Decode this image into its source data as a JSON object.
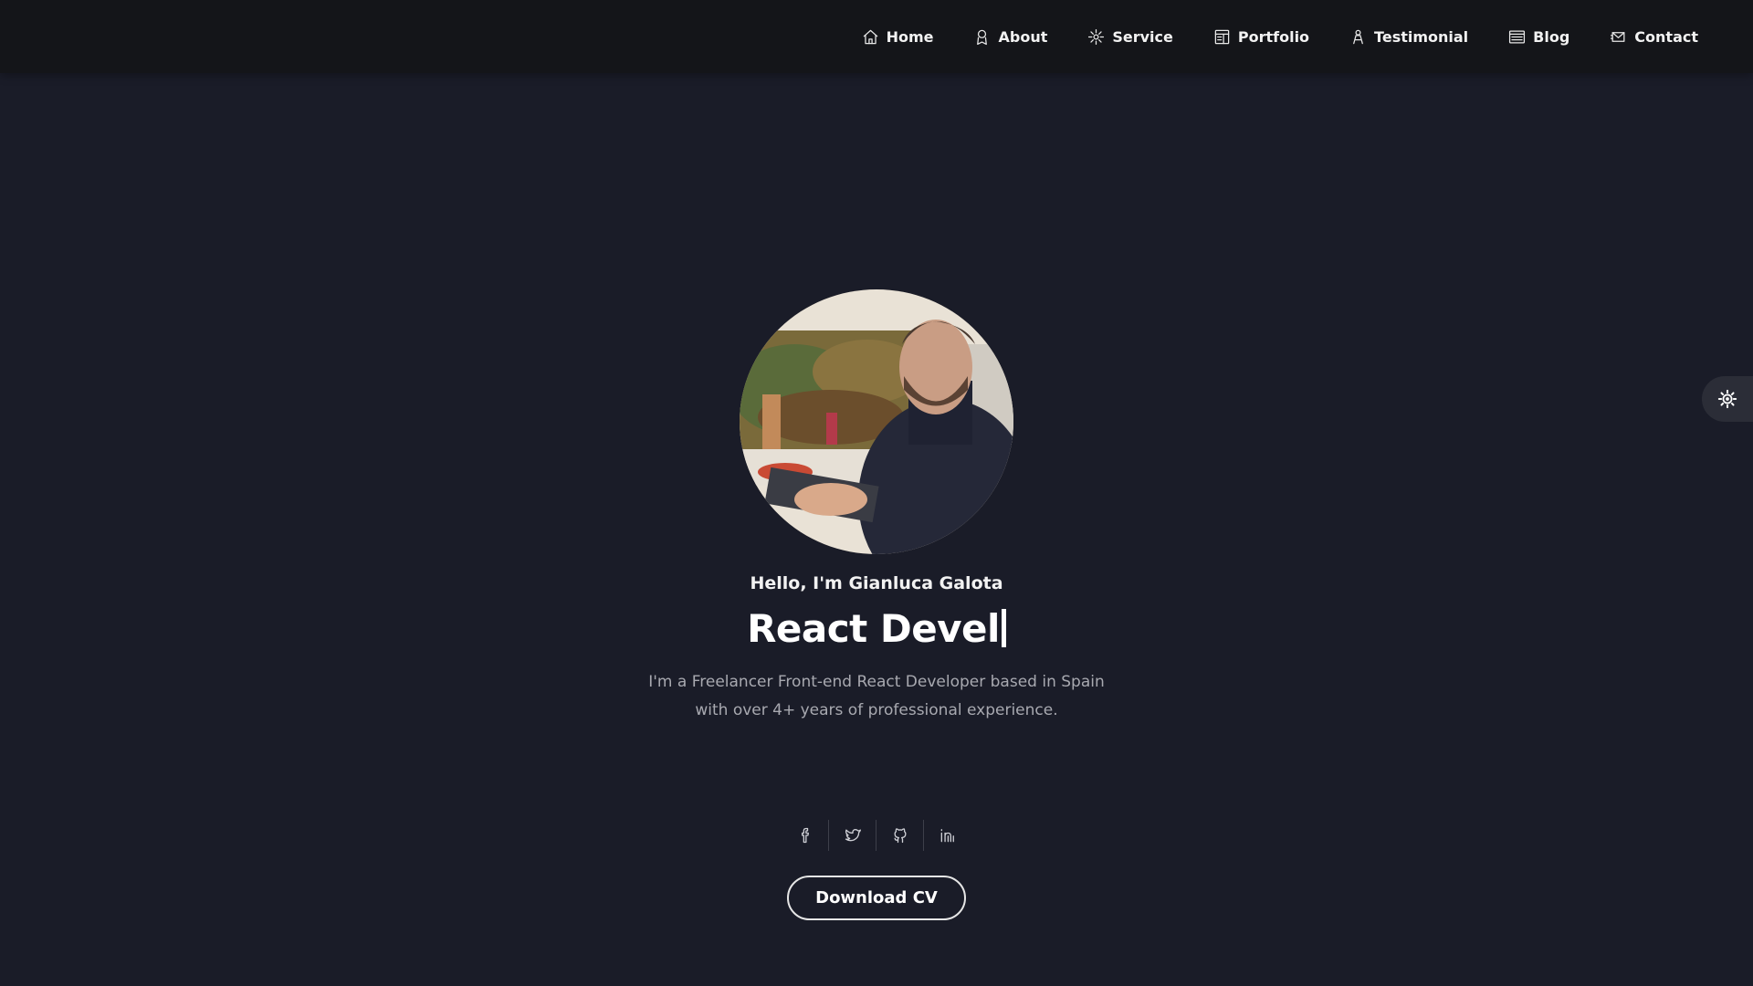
{
  "nav": {
    "items": [
      {
        "label": "Home",
        "icon": "home-icon"
      },
      {
        "label": "About",
        "icon": "user-icon"
      },
      {
        "label": "Service",
        "icon": "service-icon"
      },
      {
        "label": "Portfolio",
        "icon": "portfolio-icon"
      },
      {
        "label": "Testimonial",
        "icon": "testimonial-icon"
      },
      {
        "label": "Blog",
        "icon": "blog-icon"
      },
      {
        "label": "Contact",
        "icon": "contact-icon"
      }
    ]
  },
  "hero": {
    "greeting": "Hello, I'm Gianluca Galota",
    "role": "React Devel",
    "description_line1": "I'm a Freelancer Front-end React Developer based in Spain",
    "description_line2": "with over 4+ years of professional experience.",
    "cv_label": "Download CV"
  },
  "socials": [
    "facebook-icon",
    "twitter-icon",
    "github-icon",
    "linkedin-icon"
  ],
  "theme_toggle": {
    "icon": "sun-icon"
  },
  "colors": {
    "background": "#1a1c28",
    "navbar": "#141519",
    "text": "#ffffff",
    "muted": "#a8a9b0",
    "toggle_bg": "#2b2d37"
  }
}
